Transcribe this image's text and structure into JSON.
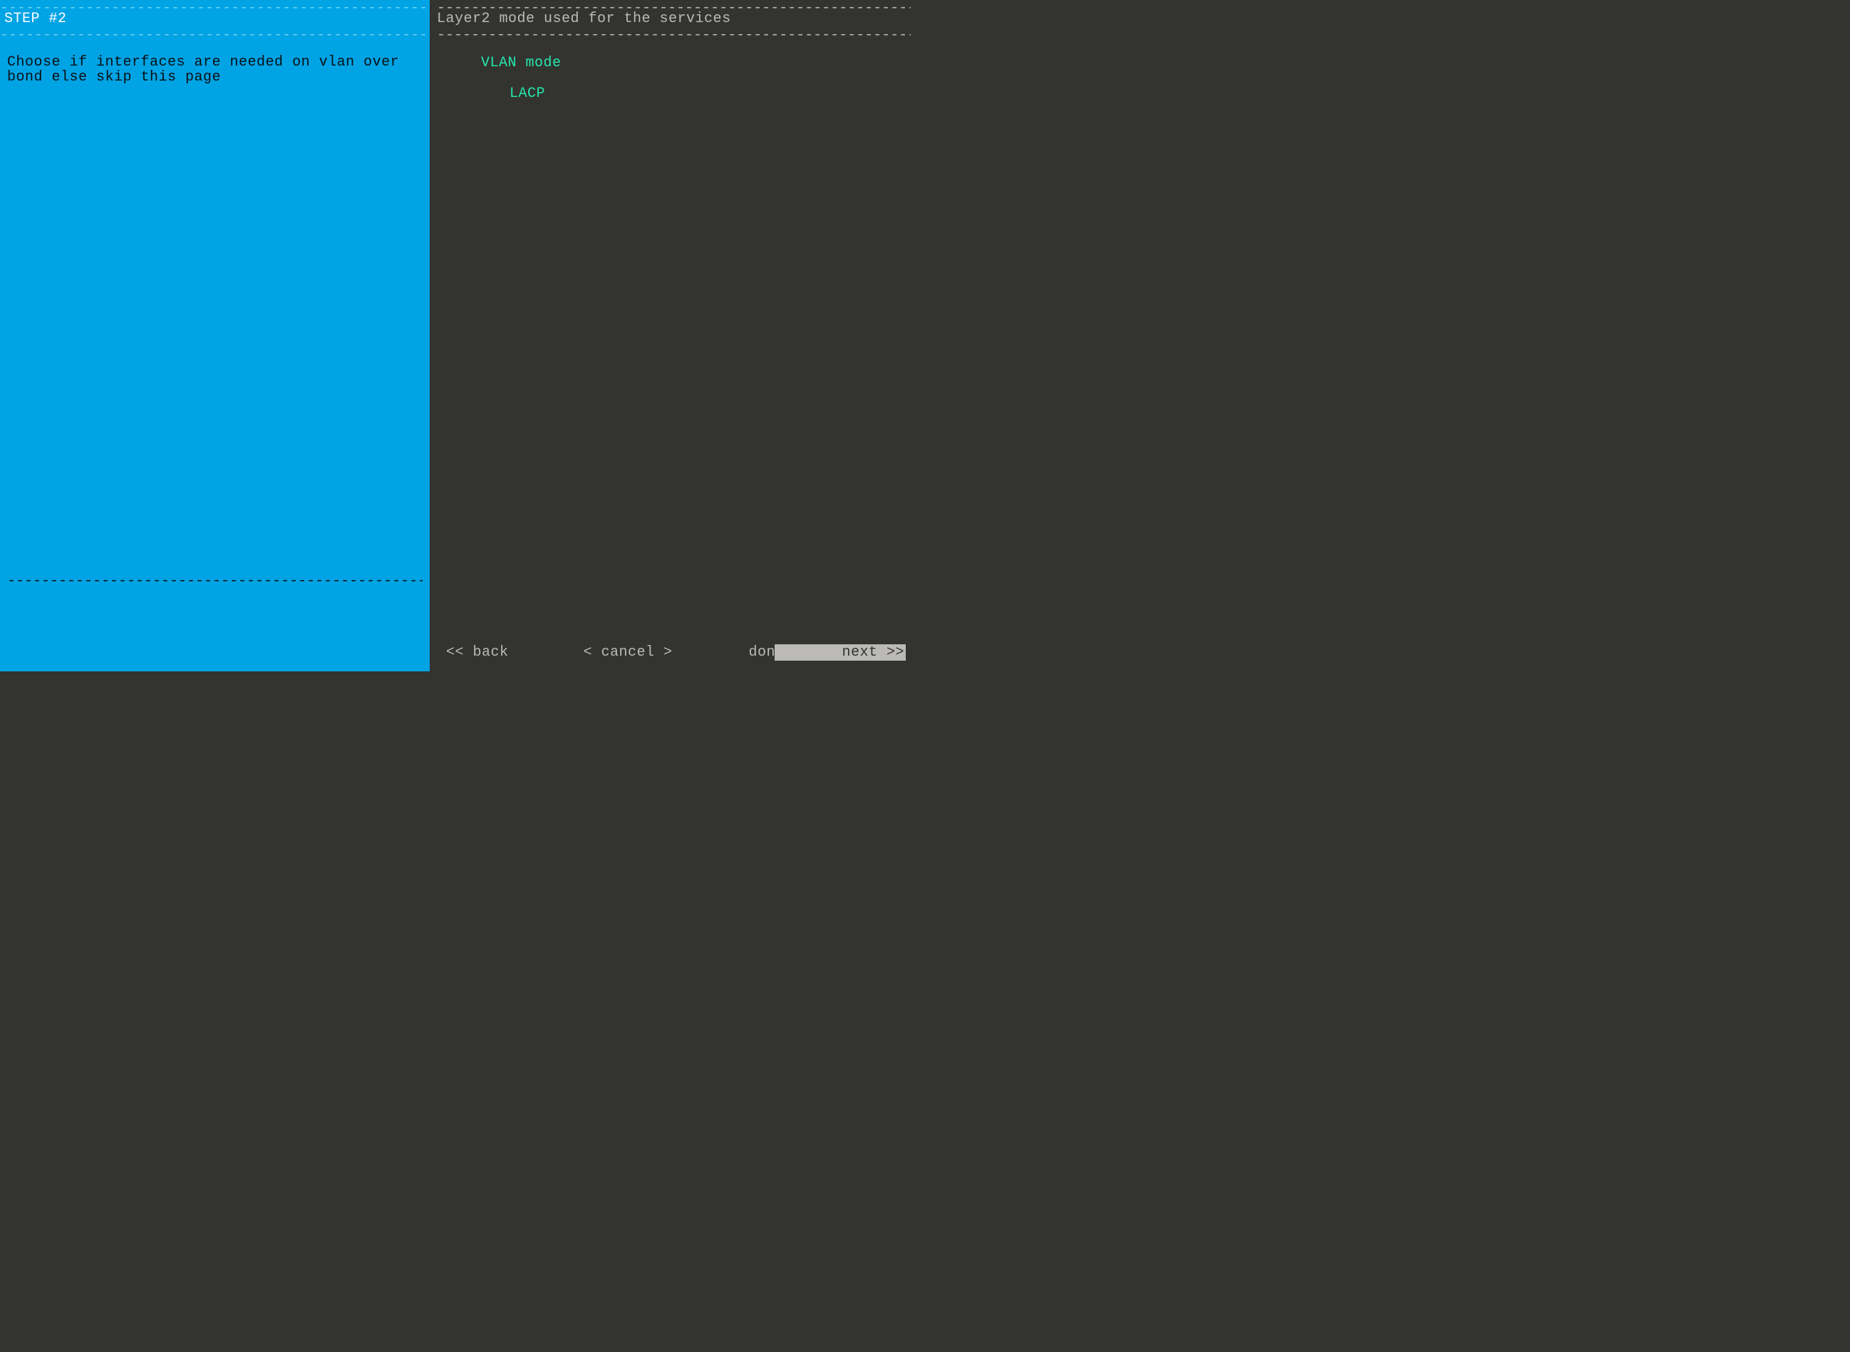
{
  "left": {
    "dash_top": "-------------------------------------------------------------",
    "step_title": "STEP #2",
    "dash_sub": "-------------------------------------------------------------",
    "instruction": "Choose if interfaces are needed on vlan over bond else skip this page",
    "dash_bottom": "-----------------------------------------------------------"
  },
  "right": {
    "dash_top": "-------------------------------------------------------------------",
    "title": "Layer2 mode used for the services",
    "dash_sub": "-------------------------------------------------------------------",
    "options": {
      "opt0": "VLAN mode",
      "opt1": "LACP"
    }
  },
  "footer": {
    "back": "<< back",
    "cancel": "< cancel >",
    "done": "done >>",
    "next": "next >>"
  }
}
